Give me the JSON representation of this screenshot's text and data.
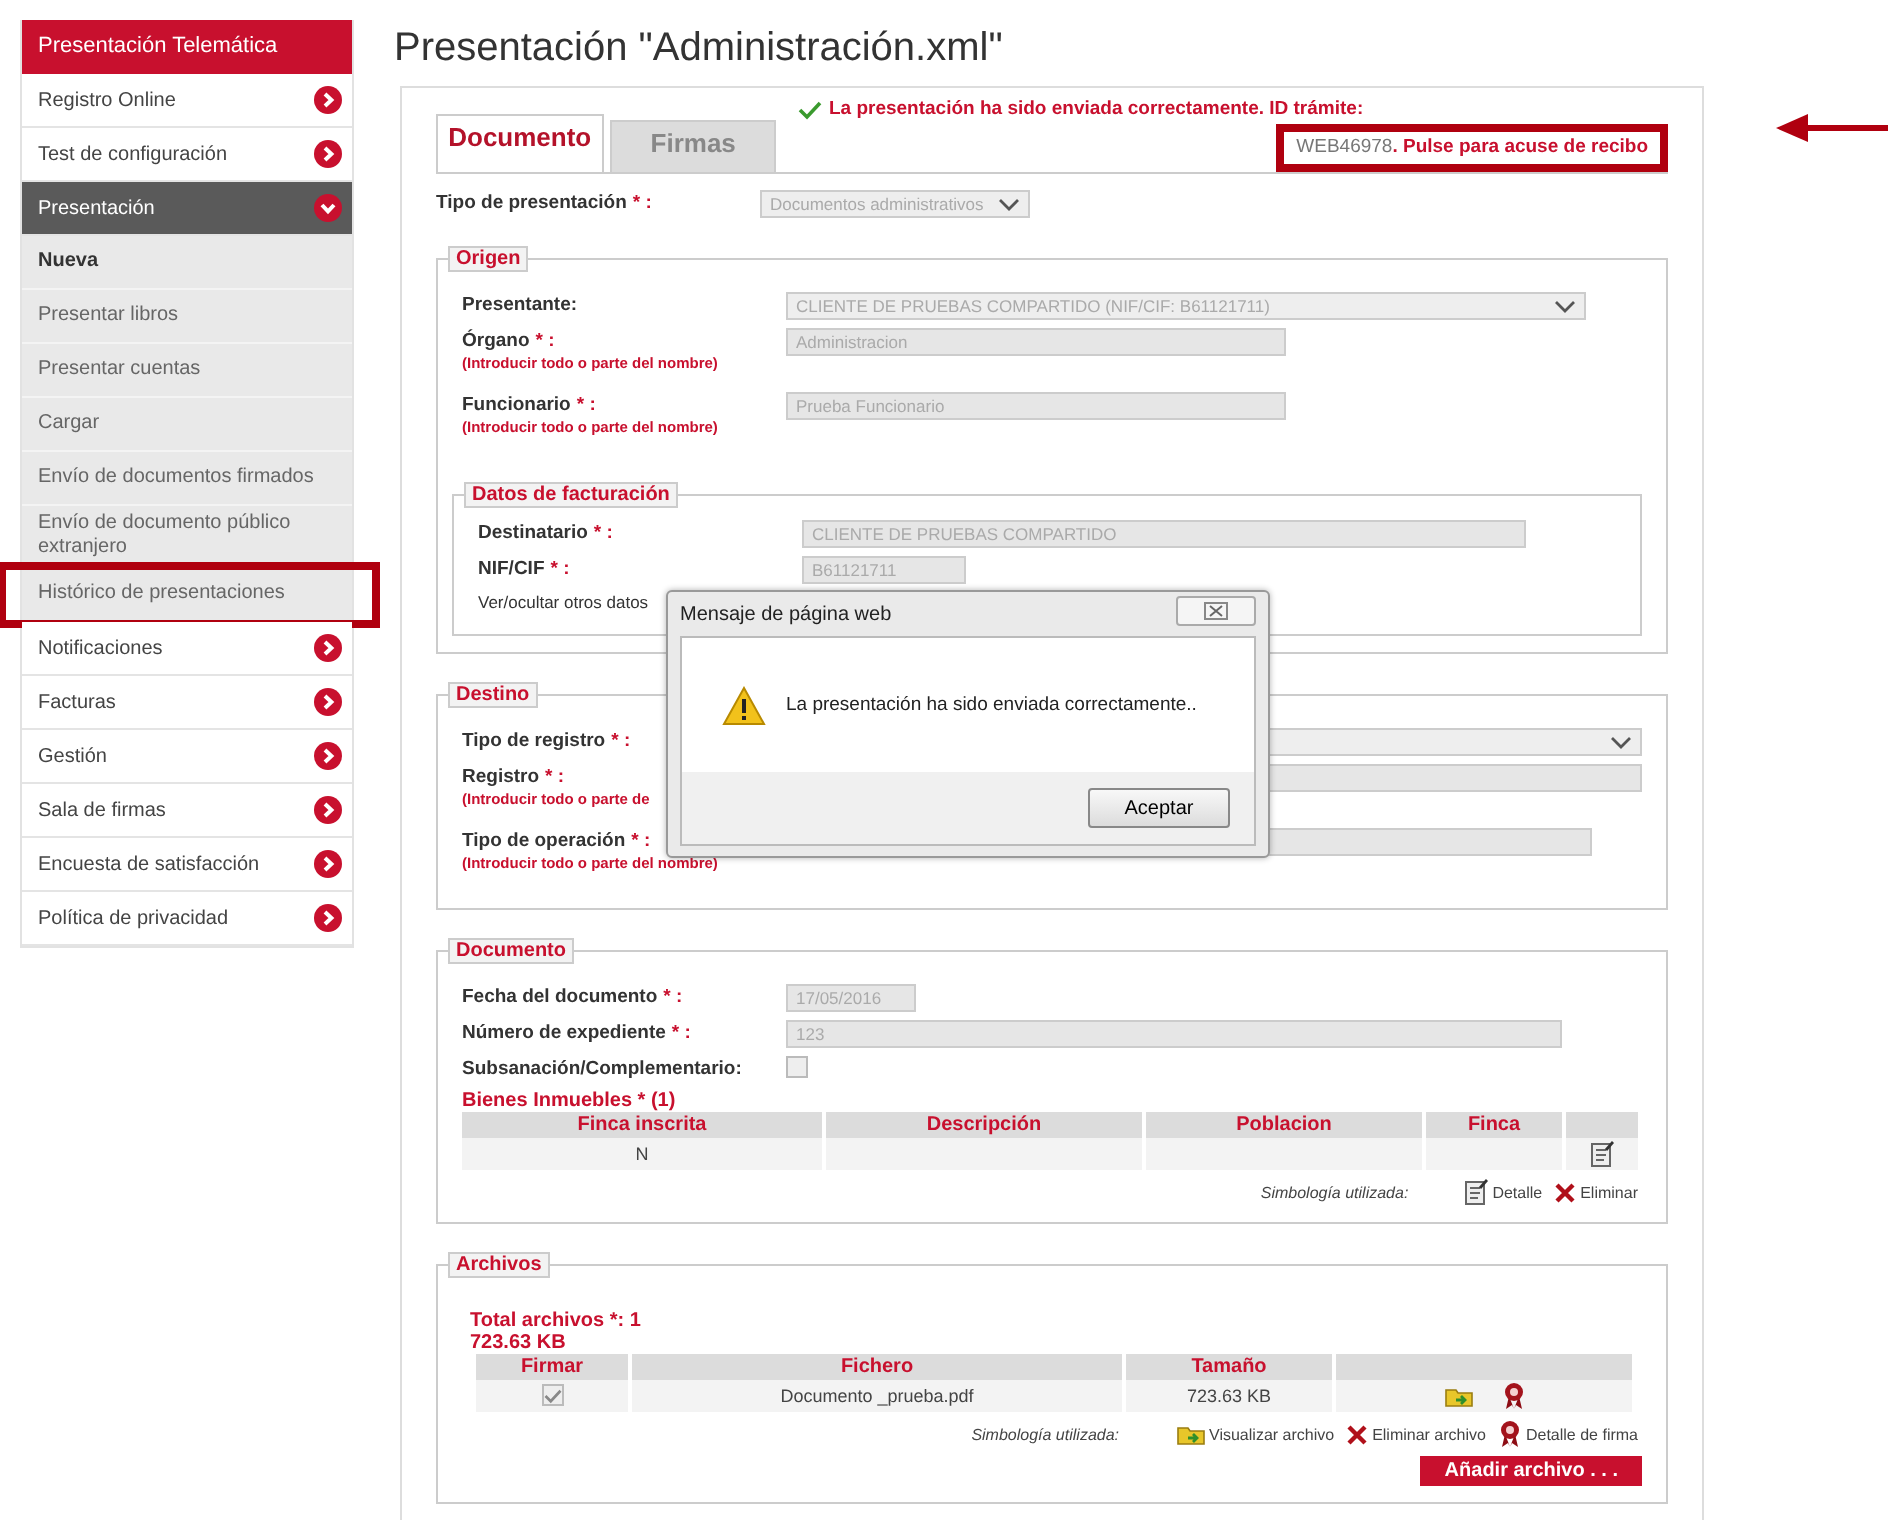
{
  "sidebar": {
    "title": "Presentación Telemática",
    "items": [
      {
        "label": "Registro Online",
        "kind": "menu",
        "expanded": false,
        "selected": false,
        "highlighted": false
      },
      {
        "label": "Test de configuración",
        "kind": "menu",
        "expanded": false,
        "selected": false,
        "highlighted": false
      },
      {
        "label": "Presentación",
        "kind": "menu",
        "expanded": true,
        "selected": false,
        "highlighted": false
      },
      {
        "label": "Nueva",
        "kind": "sub",
        "selected": true,
        "highlighted": false
      },
      {
        "label": "Presentar libros",
        "kind": "sub",
        "selected": false,
        "highlighted": false
      },
      {
        "label": "Presentar cuentas",
        "kind": "sub",
        "selected": false,
        "highlighted": false
      },
      {
        "label": "Cargar",
        "kind": "sub",
        "selected": false,
        "highlighted": false
      },
      {
        "label": "Envío de documentos firmados",
        "kind": "sub",
        "selected": false,
        "highlighted": false
      },
      {
        "label": "Envío de documento público extranjero",
        "kind": "sub",
        "selected": false,
        "highlighted": false
      },
      {
        "label": "Histórico de presentaciones",
        "kind": "sub",
        "selected": false,
        "highlighted": true
      },
      {
        "label": "Notificaciones",
        "kind": "menu",
        "expanded": false,
        "selected": false,
        "highlighted": false
      },
      {
        "label": "Facturas",
        "kind": "menu",
        "expanded": false,
        "selected": false,
        "highlighted": false
      },
      {
        "label": "Gestión",
        "kind": "menu",
        "expanded": false,
        "selected": false,
        "highlighted": false
      },
      {
        "label": "Sala de firmas",
        "kind": "menu",
        "expanded": false,
        "selected": false,
        "highlighted": false
      },
      {
        "label": "Encuesta de satisfacción",
        "kind": "menu",
        "expanded": false,
        "selected": false,
        "highlighted": false
      },
      {
        "label": "Política de privacidad",
        "kind": "menu",
        "expanded": false,
        "selected": false,
        "highlighted": false
      }
    ]
  },
  "page_title": "Presentación \"Administración.xml\"",
  "tabs": [
    {
      "label": "Documento",
      "selected": true
    },
    {
      "label": "Firmas",
      "selected": false
    }
  ],
  "status": {
    "message": "La presentación ha sido enviada correctamente. ID trámite:",
    "id": "WEB46978",
    "link": ". Pulse para acuse de recibo",
    "highlighted": true
  },
  "top_fields": [
    {
      "kind": "select",
      "label": "Tipo de presentación",
      "mark": "* :",
      "value": "Documentos administrativos"
    }
  ],
  "sections": [
    {
      "legend": "Origen",
      "fields": [
        {
          "kind": "select",
          "label": "Presentante:",
          "value": "CLIENTE DE PRUEBAS COMPARTIDO (NIF/CIF: B61121711)"
        },
        {
          "kind": "text",
          "label": "Órgano",
          "mark": "* :",
          "hint": "(Introducir todo o parte del nombre)",
          "value": "Administracion"
        },
        {
          "kind": "text",
          "label": "Funcionario",
          "mark": "* :",
          "hint": "(Introducir todo o parte del nombre)",
          "value": "Prueba Funcionario"
        }
      ],
      "subsections": [
        {
          "legend": "Datos de facturación",
          "fields": [
            {
              "kind": "text",
              "label": "Destinatario",
              "mark": "* :",
              "value": "CLIENTE DE PRUEBAS COMPARTIDO"
            },
            {
              "kind": "text",
              "label": "NIF/CIF",
              "mark": "* :",
              "value": "B61121711"
            },
            {
              "kind": "link",
              "label": "Ver/ocultar otros datos"
            }
          ]
        }
      ]
    },
    {
      "legend": "Destino",
      "fields": [
        {
          "kind": "select",
          "label": "Tipo de registro",
          "mark": "* :"
        },
        {
          "kind": "text",
          "label": "Registro",
          "mark": "* :",
          "hint": "(Introducir todo o parte de"
        },
        {
          "kind": "text",
          "label": "Tipo de operación",
          "mark": "* :",
          "hint": "(Introducir todo o parte del nombre)"
        }
      ]
    },
    {
      "legend": "Documento",
      "fields": [
        {
          "kind": "text",
          "label": "Fecha del documento",
          "mark": "* :",
          "value": "17/05/2016"
        },
        {
          "kind": "text",
          "label": "Número de expediente",
          "mark": "* :",
          "value": "123"
        },
        {
          "kind": "checkbox",
          "label": "Subsanación/Complementario:",
          "checked": false
        }
      ],
      "table": {
        "heading": "Bienes Inmuebles * (1)",
        "columns": [
          {
            "label": "Finca inscrita",
            "kind": "text"
          },
          {
            "label": "Descripción",
            "kind": "text"
          },
          {
            "label": "Poblacion",
            "kind": "text"
          },
          {
            "label": "Finca",
            "kind": "text"
          },
          {
            "kind": "edit"
          }
        ],
        "rows": [
          [
            "N",
            null,
            null,
            null
          ]
        ],
        "legend": {
          "label": "Simbología utilizada:",
          "items": [
            {
              "kind": "detail",
              "label": "Detalle"
            },
            {
              "kind": "delete",
              "label": "Eliminar"
            }
          ]
        }
      }
    },
    {
      "legend": "Archivos",
      "summary": [
        "Total archivos *: 1",
        "723.63 KB"
      ],
      "table": {
        "columns": [
          {
            "label": "Firmar",
            "kind": "checkbox"
          },
          {
            "label": "Fichero",
            "kind": "text"
          },
          {
            "label": "Tamaño",
            "kind": "text"
          },
          {
            "kind": "file"
          }
        ],
        "rows": [
          [
            {
              "checked": true
            },
            "Documento _prueba.pdf",
            "723.63 KB"
          ]
        ],
        "legend": {
          "label": "Simbología utilizada:",
          "items": [
            {
              "kind": "view",
              "label": "Visualizar archivo"
            },
            {
              "kind": "delete",
              "label": "Eliminar archivo"
            },
            {
              "kind": "signature",
              "label": "Detalle de firma"
            }
          ]
        }
      },
      "button": "Añadir archivo . . ."
    }
  ],
  "dialog": {
    "title": "Mensaje de página web",
    "message": "La presentación ha sido enviada correctamente..",
    "button": "Aceptar"
  }
}
